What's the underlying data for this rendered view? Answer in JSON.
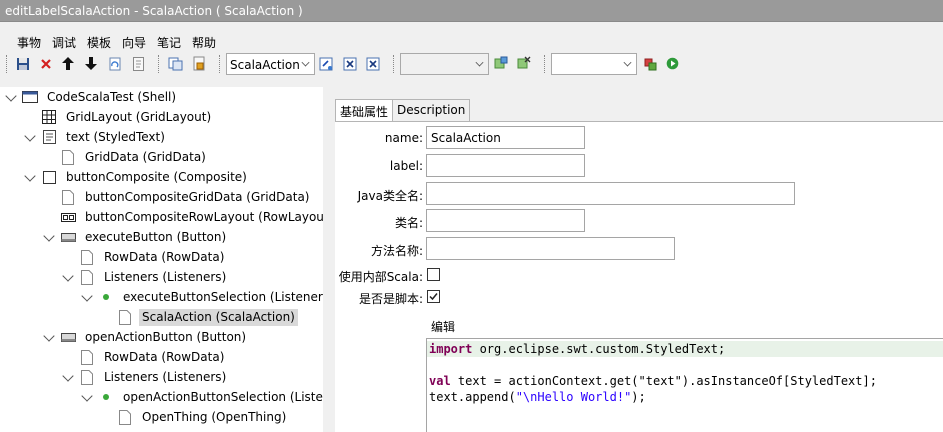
{
  "window": {
    "title": "editLabelScalaAction - ScalaAction ( ScalaAction )"
  },
  "menu": [
    "事物",
    "调试",
    "模板",
    "向导",
    "笔记",
    "帮助"
  ],
  "toolbar": {
    "combo1_value": "ScalaAction",
    "combo2_value": "",
    "combo3_value": ""
  },
  "tree": {
    "nodes": [
      {
        "label": "CodeScalaTest (Shell)",
        "icon": "shell-icon"
      },
      {
        "label": "GridLayout (GridLayout)",
        "icon": "grid-layout-icon"
      },
      {
        "label": "text (StyledText)",
        "icon": "styled-text-icon"
      },
      {
        "label": "GridData (GridData)",
        "icon": "document-icon"
      },
      {
        "label": "buttonComposite (Composite)",
        "icon": "composite-icon"
      },
      {
        "label": "buttonCompositeGridData (GridData)",
        "icon": "document-icon"
      },
      {
        "label": "buttonCompositeRowLayout (RowLayout)",
        "icon": "row-layout-icon"
      },
      {
        "label": "executeButton (Button)",
        "icon": "button-icon"
      },
      {
        "label": "RowData (RowData)",
        "icon": "document-icon"
      },
      {
        "label": "Listeners (Listeners)",
        "icon": "document-icon"
      },
      {
        "label": "executeButtonSelection (Listener)",
        "icon": "listener-dot-icon"
      },
      {
        "label": "ScalaAction (ScalaAction)",
        "icon": "document-icon"
      },
      {
        "label": "openActionButton (Button)",
        "icon": "button-icon"
      },
      {
        "label": "RowData (RowData)",
        "icon": "document-icon"
      },
      {
        "label": "Listeners (Listeners)",
        "icon": "document-icon"
      },
      {
        "label": "openActionButtonSelection (Listener)",
        "icon": "listener-dot-icon"
      },
      {
        "label": "OpenThing (OpenThing)",
        "icon": "document-icon"
      }
    ]
  },
  "tabs": [
    "基础属性",
    "Description"
  ],
  "form": {
    "name_label": "name:",
    "name_value": "ScalaAction",
    "label_label": "label:",
    "label_value": "",
    "java_class_label": "Java类全名:",
    "java_class_value": "",
    "class_name_label": "类名:",
    "class_name_value": "",
    "method_label": "方法名称:",
    "method_value": "",
    "internal_scala_label": "使用内部Scala:",
    "internal_scala_checked": false,
    "is_script_label": "是否是脚本:",
    "is_script_checked": true,
    "editor_label": "编辑"
  },
  "code": {
    "line1_kw": "import",
    "line1_rest": " org.eclipse.swt.custom.StyledText;",
    "line3_kw": "val",
    "line3_rest": " text = actionContext.get(\"text\").asInstanceOf[StyledText];",
    "line4_pre": "text.append(",
    "line4_str": "\"\\nHello World!\"",
    "line4_post": ");"
  },
  "colors": {
    "titlebar": "#9a9a9a",
    "keyword": "#7f0055",
    "string": "#2a00ff",
    "selection": "#d9d9d9",
    "current_line": "#e8f2e8"
  }
}
